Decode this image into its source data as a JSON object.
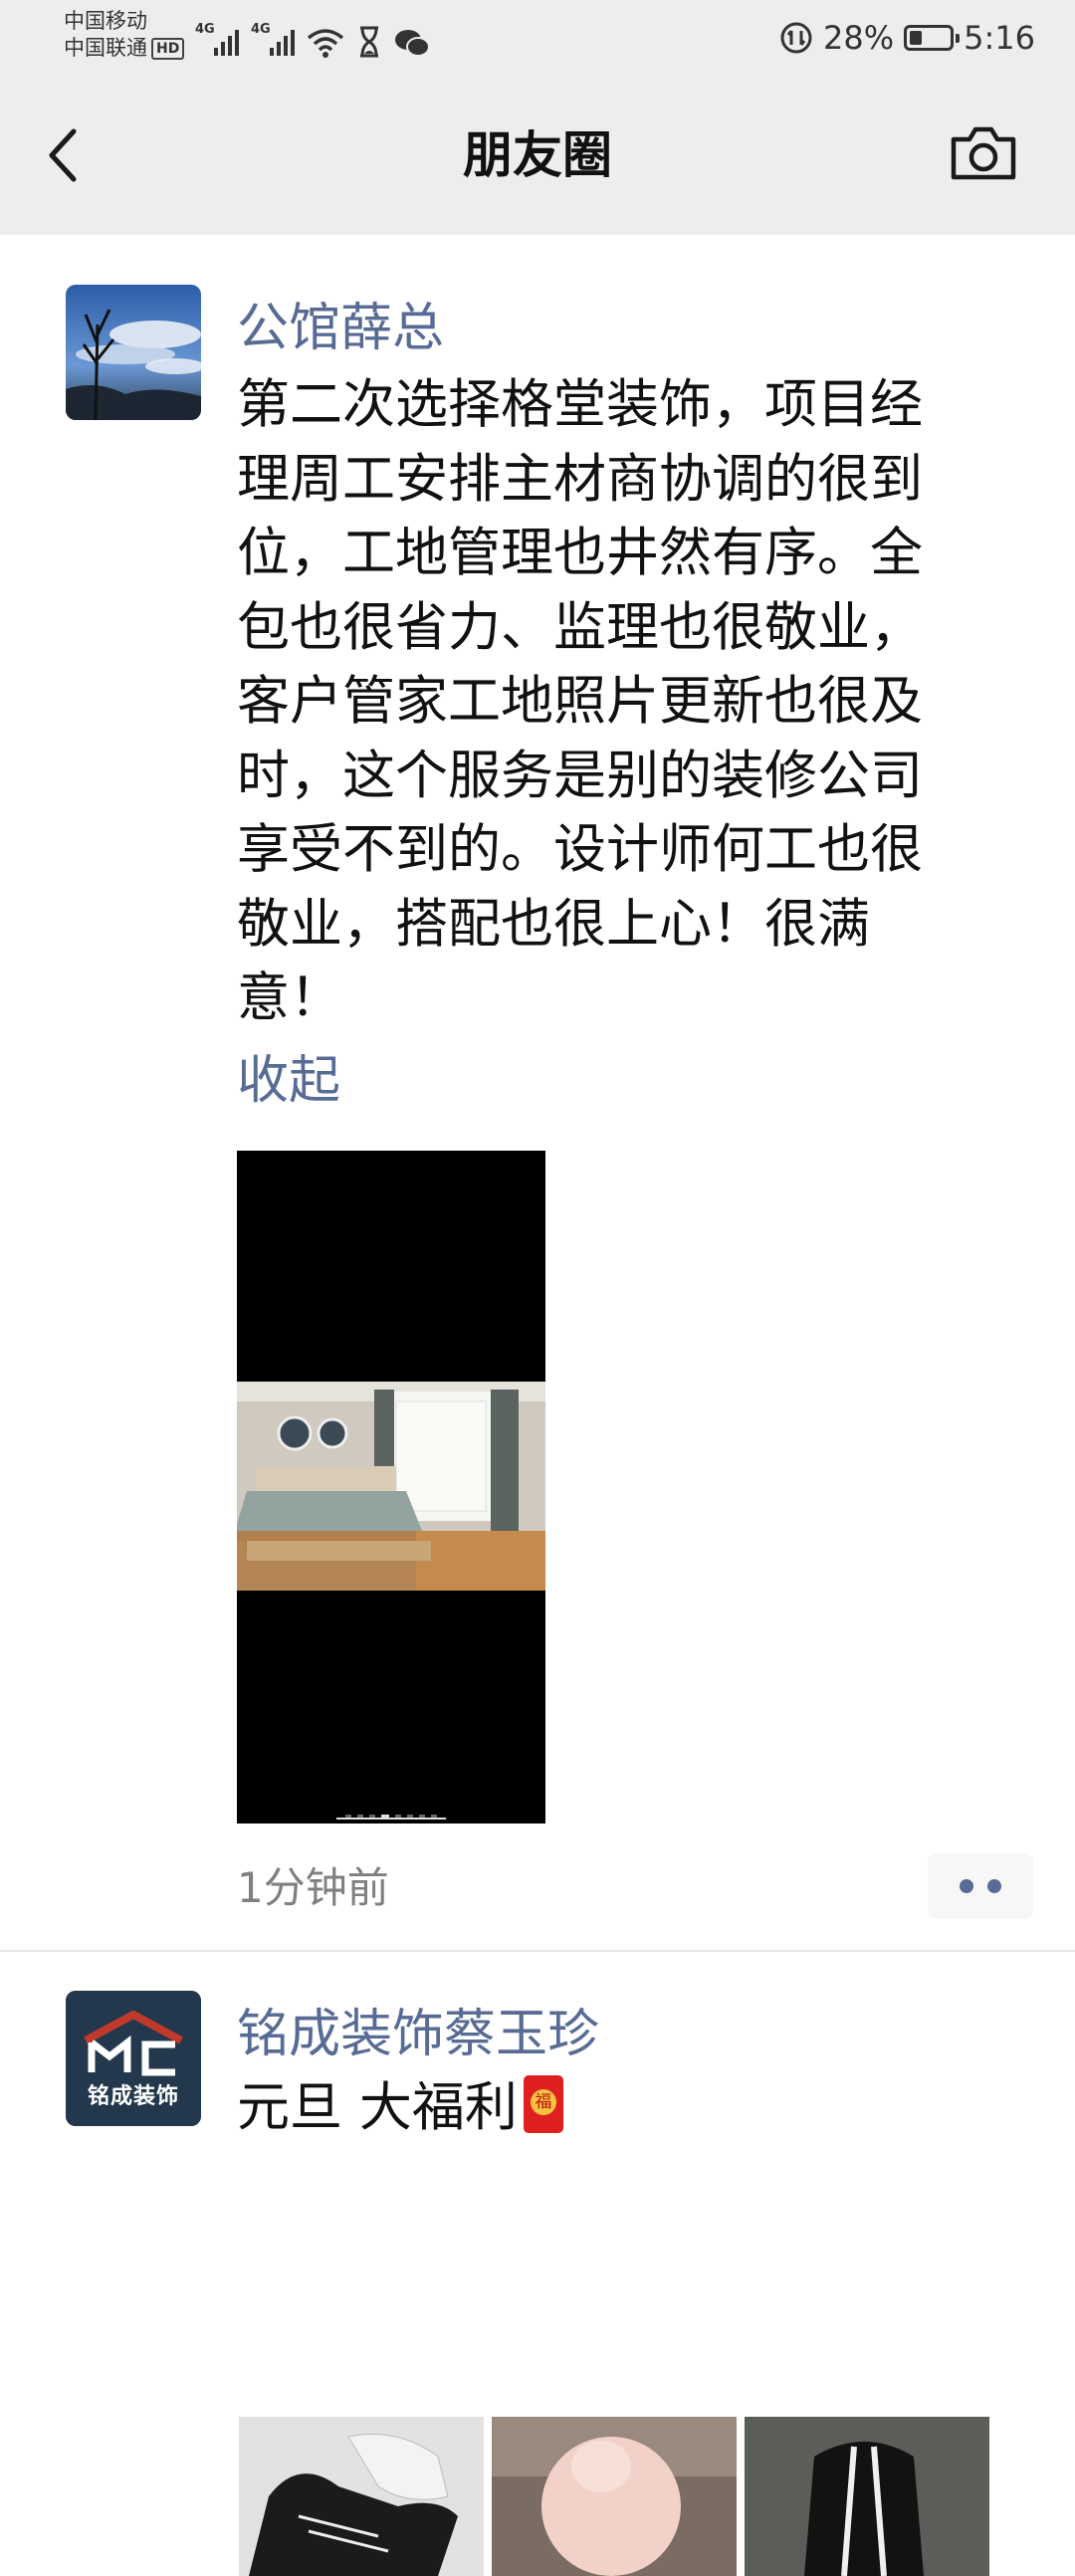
{
  "status_bar": {
    "carrier_1": "中国移动",
    "carrier_2": "中国联通",
    "hd_badge": "HD",
    "signal_1_label": "4G",
    "signal_2_label": "4G",
    "battery_percent": "28%",
    "battery_level": 0.28,
    "time": "5:16"
  },
  "nav": {
    "title": "朋友圈",
    "back_icon": "chevron-left-icon",
    "camera_icon": "camera-icon"
  },
  "posts": [
    {
      "author": "公馆薛总",
      "text_lines": [
        "第二次选择格堂装饰，项目经",
        "理周工安排主材商协调的很到",
        "位，工地管理也井然有序。全",
        "包也很省力、监理也很敬业，",
        "客户管家工地照片更新也很及",
        "时，这个服务是别的装修公司",
        "享受不到的。设计师何工也很",
        "敬业，搭配也很上心！很满",
        "意！"
      ],
      "collapse_label": "收起",
      "timestamp": "1分钟前"
    },
    {
      "author": "铭成装饰蔡玉珍",
      "text": "元旦 大福利",
      "avatar_logo_text": "铭成装饰"
    }
  ],
  "colors": {
    "link_blue": "#576b95",
    "header_bg": "#ededed",
    "timestamp_gray": "#7f7f7f"
  }
}
